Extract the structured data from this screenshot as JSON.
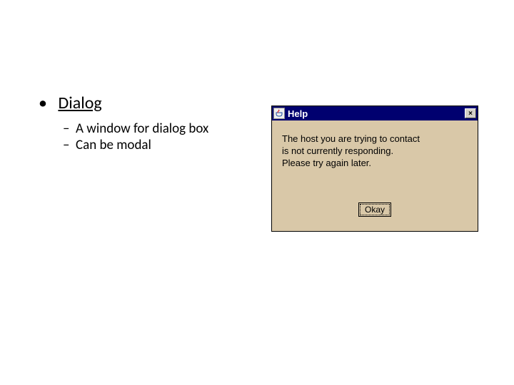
{
  "slide": {
    "bullet_title": "Dialog",
    "sub_items": [
      "A window for dialog box",
      "Can be modal"
    ]
  },
  "dialog": {
    "icon_name": "java-cup",
    "title": "Help",
    "close_label": "×",
    "message_line1": "The host you are trying to contact",
    "message_line2": "is not currently responding.",
    "message_line3": "Please try again later.",
    "ok_label": "Okay"
  }
}
